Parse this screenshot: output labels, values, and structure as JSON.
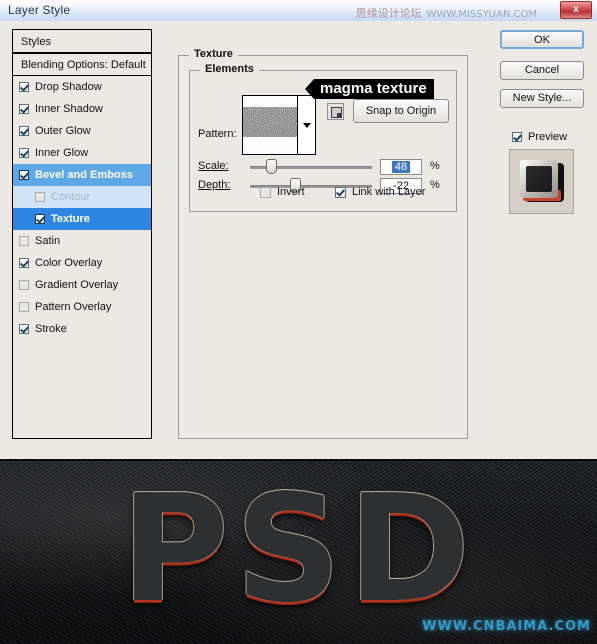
{
  "window": {
    "title": "Layer Style",
    "close_label": "x",
    "watermark_cn": "思缘设计论坛",
    "watermark_url": "WWW.MISSYUAN.COM"
  },
  "styles_panel": {
    "header": "Styles",
    "blending_options": "Blending Options: Default",
    "items": [
      {
        "label": "Drop Shadow",
        "checked": true,
        "selected": false,
        "sub": false
      },
      {
        "label": "Inner Shadow",
        "checked": true,
        "selected": false,
        "sub": false
      },
      {
        "label": "Outer Glow",
        "checked": true,
        "selected": false,
        "sub": false
      },
      {
        "label": "Inner Glow",
        "checked": true,
        "selected": false,
        "sub": false
      },
      {
        "label": "Bevel and Emboss",
        "checked": true,
        "selected": true,
        "sub": false
      },
      {
        "label": "Contour",
        "checked": false,
        "selected": false,
        "sub": true
      },
      {
        "label": "Texture",
        "checked": true,
        "selected": true,
        "sub": true
      },
      {
        "label": "Satin",
        "checked": false,
        "selected": false,
        "sub": false
      },
      {
        "label": "Color Overlay",
        "checked": true,
        "selected": false,
        "sub": false
      },
      {
        "label": "Gradient Overlay",
        "checked": false,
        "selected": false,
        "sub": false
      },
      {
        "label": "Pattern Overlay",
        "checked": false,
        "selected": false,
        "sub": false
      },
      {
        "label": "Stroke",
        "checked": true,
        "selected": false,
        "sub": false
      }
    ]
  },
  "texture": {
    "group_title": "Texture",
    "elements_title": "Elements",
    "pattern_label": "Pattern:",
    "snap_to_origin_label": "Snap to Origin",
    "callout_label": "magma texture",
    "scale_label": "Scale:",
    "scale_value": "48",
    "scale_unit": "%",
    "depth_label": "Depth:",
    "depth_value": "-22",
    "depth_unit": "%",
    "invert_label": "Invert",
    "invert_checked": false,
    "link_with_layer_label": "Link with Layer",
    "link_with_layer_checked": true
  },
  "actions": {
    "ok": "OK",
    "cancel": "Cancel",
    "new_style": "New Style...",
    "preview_label": "Preview",
    "preview_checked": true
  },
  "stage": {
    "text": "PSD",
    "watermark": "WWW.CNBAIMA.COM"
  },
  "colors": {
    "selection_blue": "#5fa8e8",
    "selection_blue_dark": "#2f86e0",
    "dialog_bg": "#ece9e4",
    "accent_red": "#b0341c",
    "stage_watermark": "#39a6d8"
  }
}
